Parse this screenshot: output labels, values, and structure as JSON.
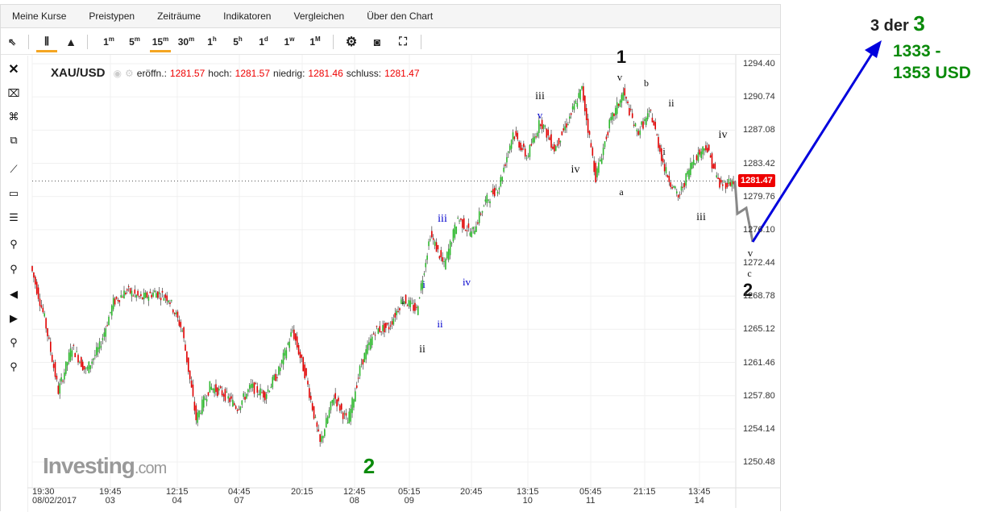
{
  "menu": [
    "Meine Kurse",
    "Preistypen",
    "Zeiträume",
    "Indikatoren",
    "Vergleichen",
    "Über den Chart"
  ],
  "toolbar": {
    "intervals": [
      {
        "n": "1",
        "u": "m"
      },
      {
        "n": "5",
        "u": "m"
      },
      {
        "n": "15",
        "u": "m"
      },
      {
        "n": "30",
        "u": "m"
      },
      {
        "n": "1",
        "u": "h"
      },
      {
        "n": "5",
        "u": "h"
      },
      {
        "n": "1",
        "u": "d"
      },
      {
        "n": "1",
        "u": "w"
      },
      {
        "n": "1",
        "u": "M"
      }
    ],
    "active_interval": "15m",
    "active_chart_type": "candlestick"
  },
  "info": {
    "symbol": "XAU/USD",
    "open_label": "eröffn.:",
    "open": "1281.57",
    "high_label": "hoch:",
    "high": "1281.57",
    "low_label": "niedrig:",
    "low": "1281.46",
    "close_label": "schluss:",
    "close": "1281.47"
  },
  "price_tag": "1281.47",
  "logo": {
    "main": "Investing",
    "suffix": ".com"
  },
  "annotation_right": {
    "line1a": "3 der ",
    "line1b": "3",
    "line2": "1333 -",
    "line3": "1353 USD"
  },
  "colors": {
    "up": "#2db82d",
    "down": "#e00000",
    "arrow": "#0000dd",
    "green_text": "#0a8a0a"
  },
  "chart_data": {
    "type": "candlestick",
    "symbol": "XAU/USD",
    "ylim": [
      1249,
      1296
    ],
    "y_ticks": [
      "1294.40",
      "1290.74",
      "1287.08",
      "1283.42",
      "1279.76",
      "1276.10",
      "1272.44",
      "1268.78",
      "1265.12",
      "1261.46",
      "1257.80",
      "1254.14",
      "1250.48"
    ],
    "x_ticks": [
      [
        "19:30",
        "08/02/2017"
      ],
      [
        "19:45",
        "03"
      ],
      [
        "12:15",
        "04"
      ],
      [
        "04:45",
        "07"
      ],
      [
        "20:15",
        ""
      ],
      [
        "12:45",
        "08"
      ],
      [
        "05:15",
        "09"
      ],
      [
        "20:45",
        ""
      ],
      [
        "13:15",
        "10"
      ],
      [
        "05:45",
        "11"
      ],
      [
        "21:15",
        ""
      ],
      [
        "13:45",
        "14"
      ]
    ],
    "price_path": [
      1272.1,
      1266.3,
      1258.3,
      1263.2,
      1260.5,
      1263.2,
      1268.1,
      1269.4,
      1268.5,
      1269.2,
      1268.6,
      1265.0,
      1255.2,
      1258.8,
      1258.0,
      1256.5,
      1258.8,
      1257.9,
      1260.5,
      1265.0,
      1259.7,
      1252.5,
      1257.8,
      1254.8,
      1261.4,
      1265.0,
      1265.4,
      1268.5,
      1267.2,
      1275.6,
      1272.1,
      1277.4,
      1275.6,
      1279.2,
      1281.0,
      1286.8,
      1284.1,
      1288.1,
      1285.0,
      1288.1,
      1291.6,
      1281.9,
      1287.7,
      1291.2,
      1286.8,
      1289.0,
      1282.8,
      1279.6,
      1283.6,
      1285.4,
      1281.0,
      1281.47
    ],
    "projection": [
      1281.47,
      1278.0,
      1275.0
    ],
    "wave_labels": [
      "1",
      "v",
      "b",
      "ii",
      "iii",
      "v",
      "iv",
      "a",
      "i",
      "iv",
      "iii",
      "iii",
      "iv",
      "i",
      "ii",
      "i",
      "ii",
      "v",
      "c",
      "2",
      "2"
    ]
  }
}
